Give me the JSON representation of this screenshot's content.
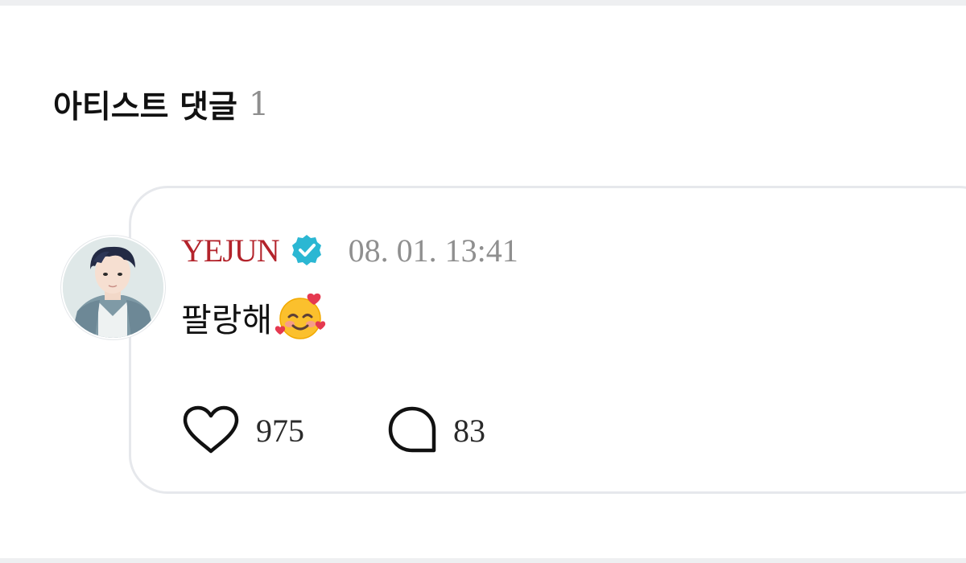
{
  "section": {
    "title": "아티스트 댓글",
    "count": "1"
  },
  "comment": {
    "author": "YEJUN",
    "verified_icon": "verified-badge-icon",
    "timestamp": "08. 01. 13:41",
    "text": "팔랑해",
    "emoji": "smiling-face-with-hearts-icon",
    "likes": "975",
    "replies": "83"
  },
  "colors": {
    "author": "#b3232b",
    "verified": "#2bb7d3",
    "muted": "#8f8f8f",
    "card_border": "#e6e8ec"
  }
}
